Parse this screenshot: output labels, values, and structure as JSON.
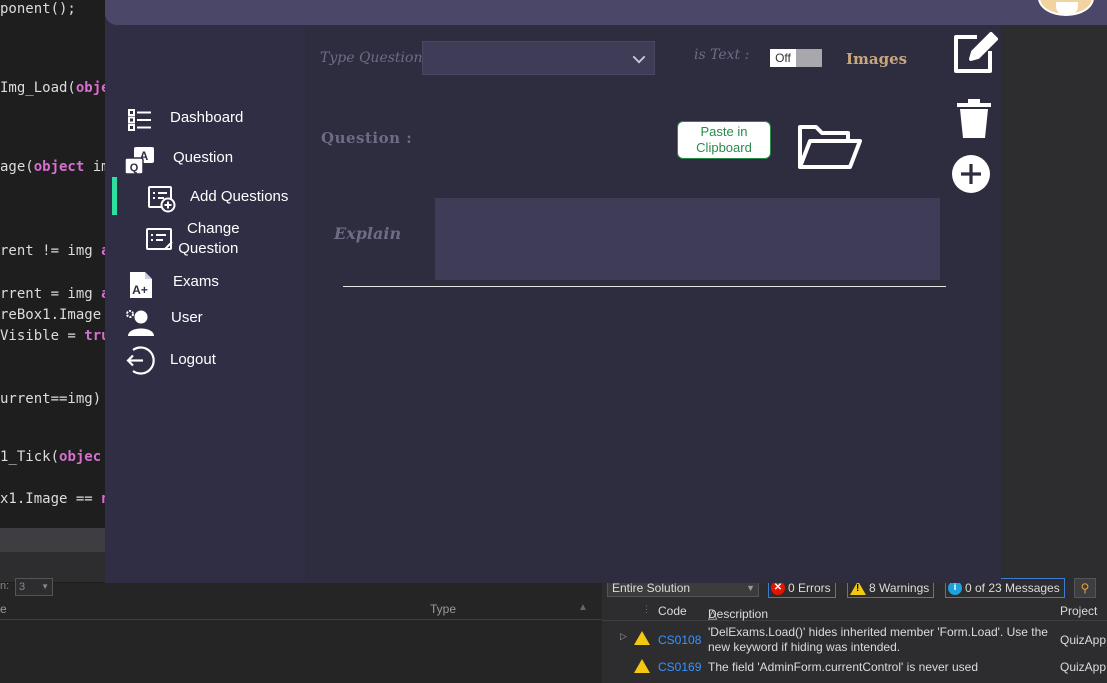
{
  "ide": {
    "code_lines": [
      {
        "pre": "ponent();",
        "kw": "",
        "post": ""
      },
      {
        "pre": "Img_Load(",
        "kw": "obje",
        "post": ""
      },
      {
        "pre": "age(",
        "kw": "object",
        "post": " im"
      },
      {
        "pre": "rent != img ",
        "kw": "a",
        "post": ""
      },
      {
        "pre": "rrent = img ",
        "kw": "a",
        "post": ""
      },
      {
        "pre": "reBox1.Image",
        "kw": "",
        "post": ""
      },
      {
        "pre": "Visible = ",
        "kw": "tru",
        "post": ""
      },
      {
        "pre": "urrent==img)",
        "kw": "",
        "post": ""
      },
      {
        "pre": "1_Tick(",
        "kw": "objec",
        "post": ""
      },
      {
        "pre": "x1.Image == ",
        "kw": "n",
        "post": ""
      }
    ],
    "line_field_label": "n:",
    "line_field_value": "3",
    "bottom_col_e": "e",
    "bottom_col_type": "Type"
  },
  "error_list": {
    "scope": "Entire Solution",
    "errors": "0 Errors",
    "warnings": "8 Warnings",
    "messages": "0 of 23 Messages",
    "columns": {
      "code": "Code",
      "description": "Description",
      "project": "Project"
    },
    "rows": [
      {
        "code": "CS0108",
        "description": "'DelExams.Load()' hides inherited member 'Form.Load'. Use the new keyword if hiding was intended.",
        "project": "QuizApp"
      },
      {
        "code": "CS0169",
        "description": "The field 'AdminForm.currentControl' is never used",
        "project": "QuizApp"
      }
    ]
  },
  "sidebar": {
    "items": [
      {
        "label": "Dashboard",
        "icon": "dashboard-list-icon"
      },
      {
        "label": "Question",
        "icon": "question-qa-icon"
      },
      {
        "label": "Add Questions",
        "icon": "add-question-icon"
      },
      {
        "label_line1": "Change",
        "label_line2": "Question",
        "icon": "edit-question-icon"
      },
      {
        "label": "Exams",
        "icon": "exam-grade-icon"
      },
      {
        "label": "User",
        "icon": "user-gear-icon"
      },
      {
        "label": "Logout",
        "icon": "logout-icon"
      }
    ],
    "active_index": 2,
    "active_color": "#2ee0a0"
  },
  "form": {
    "type_question_label": "Type Question",
    "type_question_value": "",
    "is_text_label": "is Text :",
    "is_text_toggle": "Off",
    "images_label": "Images",
    "question_label": "Question :",
    "paste_button": "Paste in Clipboard",
    "explain_label": "Explain",
    "explain_value": ""
  },
  "tools": [
    "edit-icon",
    "trash-icon",
    "add-circle-icon",
    "folder-open-icon"
  ]
}
